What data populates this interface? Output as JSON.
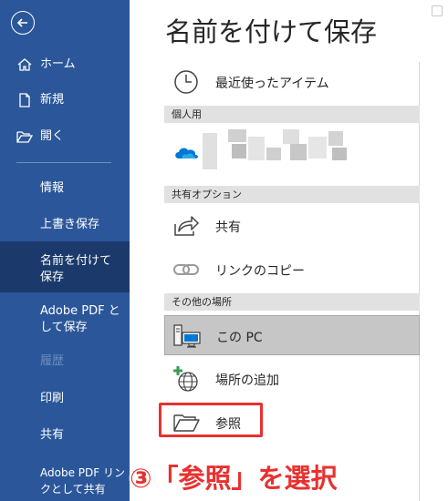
{
  "nav": {
    "items": [
      {
        "label": "ホーム",
        "icon": "home-icon"
      },
      {
        "label": "新規",
        "icon": "new-document-icon"
      },
      {
        "label": "開く",
        "icon": "open-folder-icon"
      },
      {
        "label": "情報"
      },
      {
        "label": "上書き保存"
      },
      {
        "label": "名前を付けて保存",
        "active": true
      },
      {
        "label": "Adobe PDF として保存"
      },
      {
        "label": "履歴",
        "disabled": true
      },
      {
        "label": "印刷"
      },
      {
        "label": "共有"
      },
      {
        "label": "Adobe PDF リンクとして共有"
      }
    ]
  },
  "main": {
    "title": "名前を付けて保存",
    "recent_label": "最近使ったアイテム",
    "sections": {
      "personal": "個人用",
      "share_options": "共有オプション",
      "other_places": "その他の場所"
    },
    "share_label": "共有",
    "copy_link_label": "リンクのコピー",
    "this_pc_label": "この PC",
    "add_place_label": "場所の追加",
    "browse_label": "参照"
  },
  "annotation": {
    "text": "③「参照」を選択"
  },
  "colors": {
    "nav_bg": "#2b579a",
    "nav_active": "#1b3a6b",
    "accent_red": "#e8312f",
    "onedrive_blue": "#0078d4"
  }
}
